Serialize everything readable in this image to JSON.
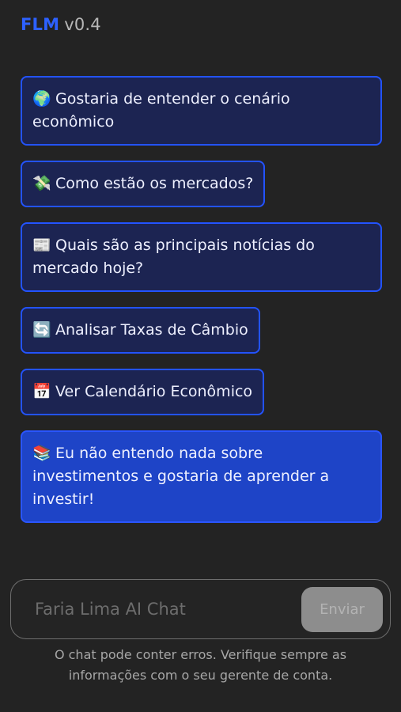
{
  "header": {
    "brand": "FLM",
    "version": "v0.4"
  },
  "suggestions": [
    {
      "emoji": "🌍",
      "text": "Gostaria de entender o cenário econômico"
    },
    {
      "emoji": "💸",
      "text": "Como estão os mercados?"
    },
    {
      "emoji": "📰",
      "text": "Quais são as principais notícias do mercado hoje?"
    },
    {
      "emoji": "🔄",
      "text": "Analisar Taxas de Câmbio"
    },
    {
      "emoji": "📅",
      "text": "Ver Calendário Econômico"
    },
    {
      "emoji": "📚",
      "text": "Eu não entendo nada sobre investimentos e gostaria de aprender a investir!"
    }
  ],
  "composer": {
    "placeholder": "Faria Lima AI Chat",
    "value": "",
    "send_label": "Enviar"
  },
  "disclaimer": "O chat pode conter erros. Verifique sempre as informações com o seu gerente de conta.",
  "colors": {
    "accent": "#2d61ff",
    "chip_background": "#1c2452",
    "primary_chip_background": "#1e44c7",
    "background": "#232323"
  }
}
